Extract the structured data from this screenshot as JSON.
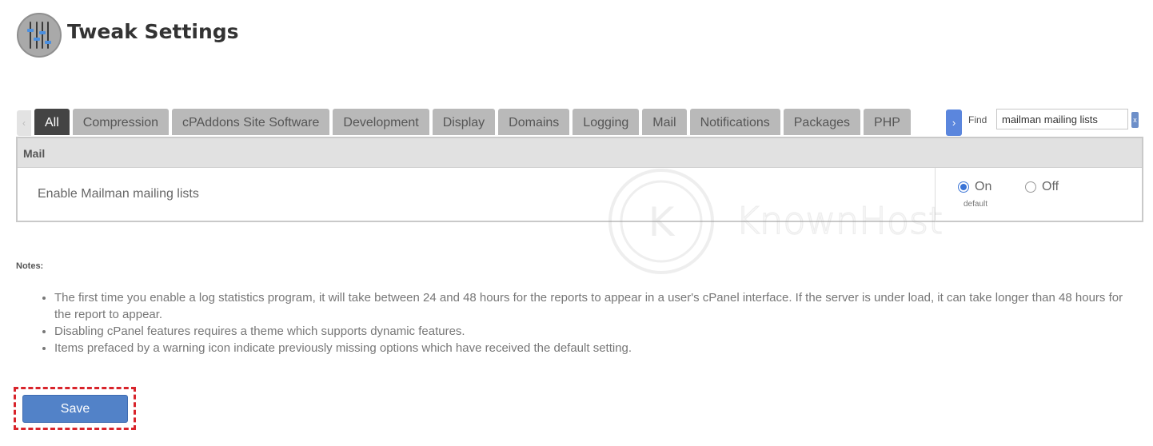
{
  "header": {
    "title": "Tweak Settings",
    "icon": "sliders-icon"
  },
  "tabs": {
    "scroll_left": "‹",
    "scroll_right": "›",
    "items": [
      {
        "label": "All",
        "active": true
      },
      {
        "label": "Compression"
      },
      {
        "label": "cPAddons Site Software"
      },
      {
        "label": "Development"
      },
      {
        "label": "Display"
      },
      {
        "label": "Domains"
      },
      {
        "label": "Logging"
      },
      {
        "label": "Mail"
      },
      {
        "label": "Notifications"
      },
      {
        "label": "Packages"
      },
      {
        "label": "PHP"
      }
    ]
  },
  "find": {
    "label": "Find",
    "value": "mailman mailing lists",
    "clear": "x"
  },
  "section": {
    "title": "Mail",
    "setting": {
      "label": "Enable Mailman mailing lists",
      "options": [
        {
          "label": "On",
          "checked": true
        },
        {
          "label": "Off",
          "checked": false
        }
      ],
      "default_note": "default"
    }
  },
  "watermark": {
    "text": "KnownHost",
    "mark": "K"
  },
  "notes": {
    "title": "Notes:",
    "items": [
      "The first time you enable a log statistics program, it will take between 24 and 48 hours for the reports to appear in a user's cPanel interface. If the server is under load, it can take longer than 48 hours for the report to appear.",
      "Disabling cPanel features requires a theme which supports dynamic features.",
      "Items prefaced by a warning icon indicate previously missing options which have received the default setting."
    ]
  },
  "actions": {
    "save_label": "Save"
  },
  "colors": {
    "active_tab": "#444444",
    "tab": "#b9b9b9",
    "save_button": "#5282c8",
    "highlight": "#d8242b",
    "radio": "#3a74d6"
  }
}
